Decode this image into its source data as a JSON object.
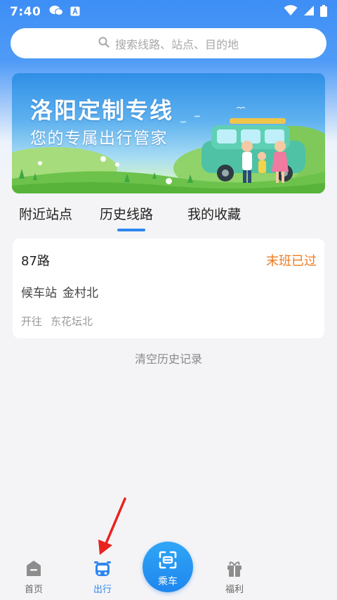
{
  "status_bar": {
    "time": "7:40"
  },
  "search": {
    "placeholder": "搜索线路、站点、目的地"
  },
  "banner": {
    "title": "洛阳定制专线",
    "subtitle": "您的专属出行管家"
  },
  "tabs": [
    {
      "label": "附近站点",
      "active": false
    },
    {
      "label": "历史线路",
      "active": true
    },
    {
      "label": "我的收藏",
      "active": false
    }
  ],
  "history_card": {
    "route_name": "87路",
    "status": "末班已过",
    "stop_label": "候车站",
    "stop_name": "金村北",
    "direction_label": "开往",
    "direction_name": "东花坛北"
  },
  "clear_history_label": "清空历史记录",
  "bottom_nav": {
    "home": "首页",
    "travel": "出行",
    "ride": "乘车",
    "welfare": "福利"
  },
  "colors": {
    "accent": "#2f86f0",
    "status_orange": "#f07a1e",
    "annotation_red": "#e8221c"
  }
}
